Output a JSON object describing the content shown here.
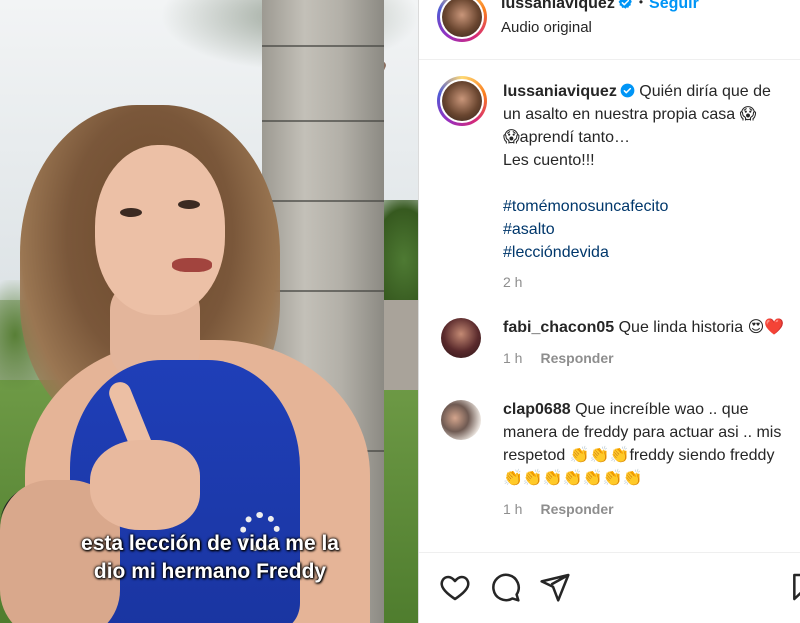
{
  "video": {
    "caption_line1": "esta lección de vida me la",
    "caption_line2": "dio mi hermano Freddy"
  },
  "header": {
    "username": "lussaniaviquez",
    "follow_label": "Seguir",
    "audio_label": "Audio original"
  },
  "post": {
    "username": "lussaniaviquez",
    "text_line1": "Quién diría que de",
    "text_line2": "un asalto en nuestra propia casa 😱",
    "text_line3": "😱aprendí tanto…",
    "text_line4": "Les cuento!!!",
    "hashtags": [
      "#tomémonosuncafecito",
      "#asalto",
      "#leccióndevida"
    ],
    "time": "2 h"
  },
  "comments": [
    {
      "username": "fabi_chacon05",
      "text": "Que linda historia 😍❤️",
      "time": "1 h",
      "reply_label": "Responder"
    },
    {
      "username": "clap0688",
      "text_line1": "Que increíble wao .. que",
      "text_line2": "manera de freddy para actuar asi .. mis",
      "text_line3": "respetod 👏👏👏freddy siendo freddy",
      "text_line4": "👏👏👏👏👏👏👏",
      "time": "1 h",
      "reply_label": "Responder"
    }
  ],
  "actions": {
    "icons": [
      "heart-icon",
      "comment-icon",
      "share-icon",
      "bookmark-icon"
    ]
  },
  "colors": {
    "follow": "#0095f6",
    "hashtag": "#00376b",
    "verified": "#0095f6",
    "muted": "#8e8e8e"
  }
}
